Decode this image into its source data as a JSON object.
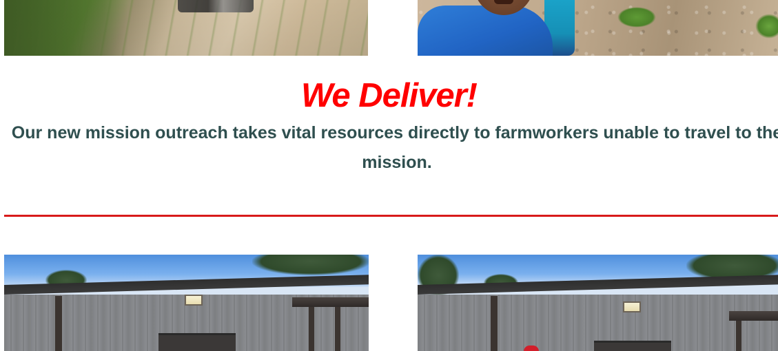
{
  "section": {
    "headline": "We Deliver!",
    "description": "Our new mission outreach takes vital resources directly to farmworkers unable to travel to the mission."
  },
  "colors": {
    "headline": "#ff0000",
    "body_text": "#2f4f4f",
    "divider": "#d81a1a",
    "background": "#ffffff"
  }
}
